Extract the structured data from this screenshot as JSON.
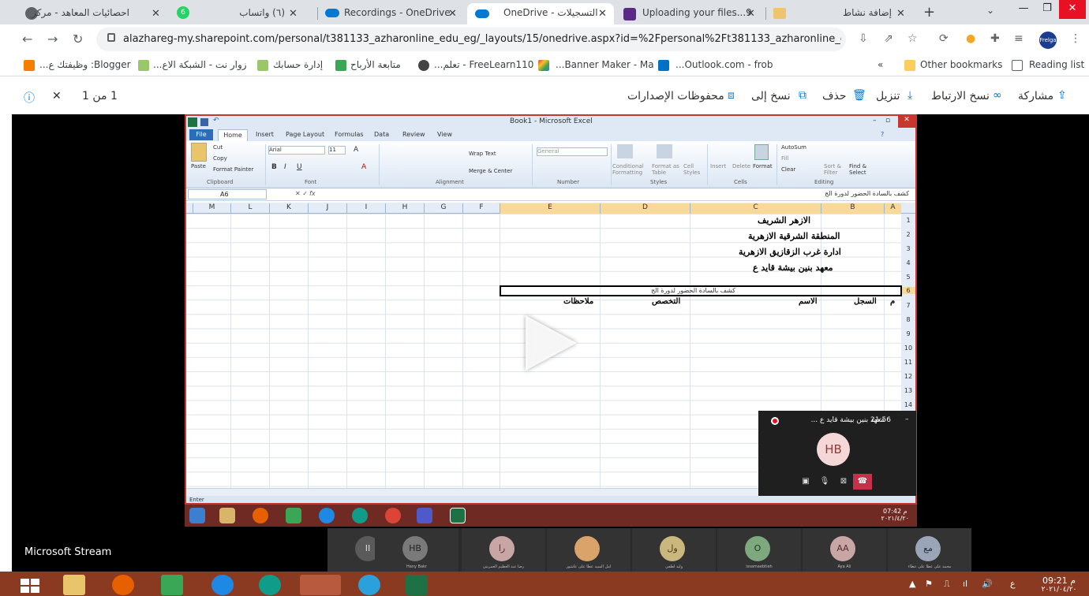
{
  "browser": {
    "tabs": [
      {
        "title": "احصائيات المعاهد - مركز",
        "badge": "6"
      },
      {
        "title": "(٦) واتساب"
      },
      {
        "title": "Recordings - OneDrive"
      },
      {
        "title": "التسجيلات - OneDrive",
        "active": true
      },
      {
        "title": "Uploading your files...9"
      },
      {
        "title": "إضافة نشاط"
      }
    ],
    "url": "alazhareg-my.sharepoint.com/personal/t381133_azharonline_edu_eg/_layouts/15/onedrive.aspx?id=%2Fpersonal%2Ft381133_azharonline_edu_eg...",
    "profile": "Frelga",
    "bookmarks": [
      "Blogger: وظيفتك ع...",
      "زوار نت - الشبكة الاع...",
      "إدارة حسابك",
      "متابعة الأرباح",
      "FreeLearn110 - تعلم...",
      "Banner Maker - Ma...",
      "Outlook.com - frob..."
    ],
    "other_bookmarks": "Other bookmarks",
    "reading_list": "Reading list",
    "more": "»"
  },
  "commands": {
    "share": "مشاركة",
    "copy_link": "نسخ الارتباط",
    "download": "تنزيل",
    "delete": "حذف",
    "copy_to": "نسخ إلى",
    "versions": "محفوظات الإصدارات",
    "page_count": "1 من 1"
  },
  "excel": {
    "title": "Book1 - Microsoft Excel",
    "tabs": [
      "File",
      "Home",
      "Insert",
      "Page Layout",
      "Formulas",
      "Data",
      "Review",
      "View"
    ],
    "ribbon": {
      "clipboard": "Clipboard",
      "font": "Font",
      "alignment": "Alignment",
      "number": "Number",
      "styles": "Styles",
      "cells": "Cells",
      "editing": "Editing",
      "cut": "Cut",
      "copy": "Copy",
      "format_painter": "Format Painter",
      "paste": "Paste",
      "font_name": "Arial",
      "font_size": "11",
      "wrap_text": "Wrap Text",
      "merge_center": "Merge & Center",
      "number_format": "General",
      "conditional": "Conditional Formatting",
      "format_table": "Format as Table",
      "cell_styles": "Cell Styles",
      "insert": "Insert",
      "delete": "Delete",
      "format": "Format",
      "autosum": "AutoSum",
      "fill": "Fill",
      "clear": "Clear",
      "sort_filter": "Sort & Filter",
      "find_select": "Find & Select"
    },
    "name_box": "A6",
    "fx": "fx",
    "formula_content": "كشف بالسادة الحضور لدورة الج",
    "columns": [
      "M",
      "L",
      "K",
      "J",
      "I",
      "H",
      "G",
      "F",
      "E",
      "D",
      "C",
      "B",
      "A"
    ],
    "rows": [
      "1",
      "2",
      "3",
      "4",
      "5",
      "6",
      "7",
      "8",
      "9",
      "10",
      "11",
      "12",
      "13",
      "14"
    ],
    "cells": {
      "r1": "الازهر الشريف",
      "r2": "المنطقة الشرقية الازهرية",
      "r3": "ادارة غرب الزقازيق الازهرية",
      "r4": "معهد بنين بيشة قايد ع",
      "r6": "كشف بالسادة الحضور لدورة الج",
      "h_m": "م",
      "h_sijil": "السجل",
      "h_name": "الاسم",
      "h_spec": "التخصص",
      "h_notes": "ملاحظات"
    },
    "status": "Enter",
    "inner_clock": {
      "time": "07:42 م",
      "date": "٢٠٢١/٤/٢٠"
    }
  },
  "call": {
    "name": "معهد بنين بيشة قايد ع ...",
    "duration": "21:56",
    "avatar": "HB",
    "minimize": "–"
  },
  "stream": {
    "label": "Microsoft Stream",
    "participants": [
      {
        "initials": "II",
        "name": "",
        "color": "#5a5a5a"
      },
      {
        "initials": "HB",
        "name": "Hany Bakr",
        "color": "#7a7a7a"
      },
      {
        "initials": "را",
        "name": "رضا عبد العظيم العمريتي",
        "color": "#c9a6a6"
      },
      {
        "initials": "",
        "name": "امل السيد عطا على عاشور",
        "color": "#d9a36a"
      },
      {
        "initials": "ول",
        "name": "وليد لطفي",
        "color": "#c9b77e"
      },
      {
        "initials": "O",
        "name": "issamaebtieh",
        "color": "#7ea87e"
      },
      {
        "initials": "AA",
        "name": "Aya Ali",
        "color": "#c9a6a6"
      },
      {
        "initials": "مع",
        "name": "محمد على عطا على عطاء",
        "color": "#9aa6b8"
      }
    ]
  },
  "taskbar": {
    "time": "09:21 م",
    "date": "٢٠٢١/٠٤/٢٠",
    "lang": "ع"
  }
}
